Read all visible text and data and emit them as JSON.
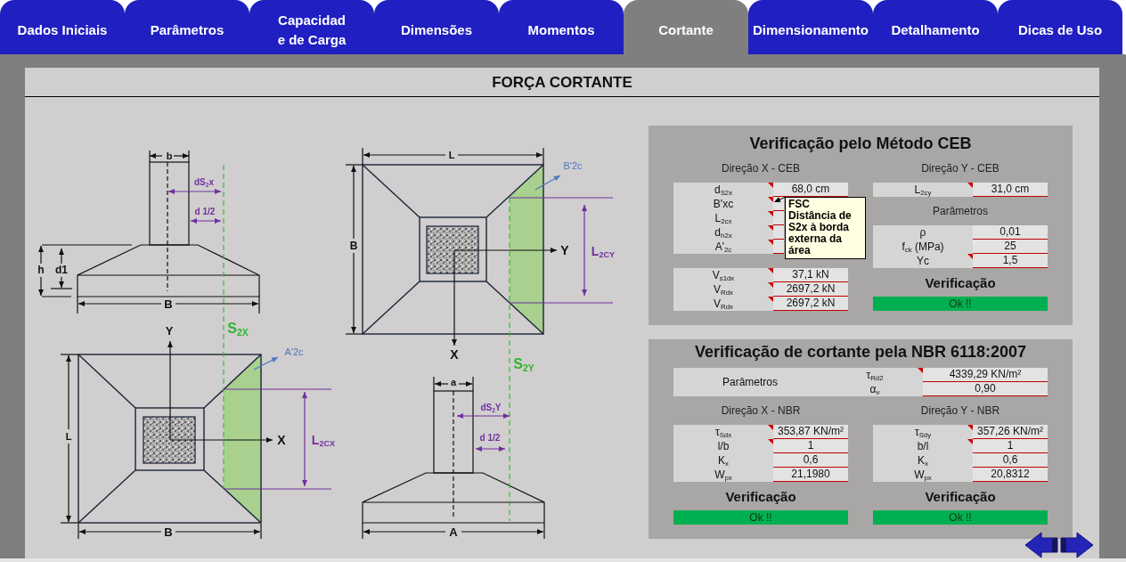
{
  "tabs": [
    {
      "label": "Dados Iniciais",
      "selected": false
    },
    {
      "label": "Parâmetros",
      "selected": false
    },
    {
      "label": "Capacidad\ne de Carga",
      "selected": false
    },
    {
      "label": "Dimensões",
      "selected": false
    },
    {
      "label": "Momentos",
      "selected": false
    },
    {
      "label": "Cortante",
      "selected": true
    },
    {
      "label": "Dimensionamento",
      "selected": false
    },
    {
      "label": "Detalhamento",
      "selected": false
    },
    {
      "label": "Dicas de Uso",
      "selected": false
    }
  ],
  "title": "FORÇA CORTANTE",
  "figure": {
    "labels": [
      "b",
      "L",
      "B'2c",
      "dS$_{2}$x",
      "d 1/2",
      "B",
      "Y",
      "L$_{2CY}$",
      "h",
      "d1",
      "B",
      "Y",
      "S$_{2X}$",
      "A'2c",
      "X",
      "S$_{2Y}$",
      "a",
      "dS$_{2}$Y",
      "L",
      "X",
      "L$_{2CX}$",
      "d 1/2",
      "B",
      "A"
    ]
  },
  "ceb": {
    "title": "Verificação pelo Método CEB",
    "direction_x": {
      "heading": "Direção X - CEB",
      "groups": [
        {
          "rows": [
            {
              "label": "d$_{S2x}$",
              "value": "68,0 cm",
              "note": true
            },
            {
              "label": "B'xc",
              "note": true
            },
            {
              "label": "L$_{2cx}$",
              "note": true
            },
            {
              "label": "d$_{h2x}$",
              "note": true
            },
            {
              "label": "A'$_{2c}$",
              "note": true
            }
          ]
        },
        {
          "rows": [
            {
              "label": "V$_{s1dx}$",
              "value": "37,1 kN",
              "note": true
            },
            {
              "label": "V$_{Rdx}$",
              "value": "2697,2 kN",
              "note": true
            },
            {
              "label": "V$_{Rdx}$",
              "value": "2697,2 kN",
              "note": true
            }
          ]
        }
      ]
    },
    "direction_y": {
      "heading": "Direção Y - CEB",
      "groups": [
        {
          "rows": [
            {
              "label": "L$_{2cy}$",
              "value": "31,0 cm",
              "note": true
            }
          ]
        },
        {
          "heading": "Parâmetros",
          "rows": [
            {
              "label": "ρ",
              "value": "0,01",
              "note": false
            },
            {
              "label": "f$_{ck}$ (MPa)",
              "value": "25",
              "note": false
            },
            {
              "label": "Yc",
              "value": "1,5",
              "note": true
            }
          ]
        }
      ],
      "verification": {
        "heading": "Verificação",
        "status": "Ok !!",
        "passed": true
      }
    },
    "tooltip": {
      "title": "FSC",
      "text": "Distância de S2x à borda externa da área"
    }
  },
  "nbr": {
    "title": "Verificação de cortante pela NBR 6118:2007",
    "parameters": {
      "label": "Parâmetros",
      "rows": [
        {
          "label": "τ$_{Rd2}$",
          "value": "4339,29 KN/m²",
          "note": true
        },
        {
          "label": "α$_{v}$",
          "value": "0,90",
          "note": false
        }
      ]
    },
    "direction_x": {
      "heading": "Direção X - NBR",
      "groups": [
        {
          "rows": [
            {
              "label": "τ$_{Sdx}$",
              "value": "353,87 KN/m²",
              "note": true
            },
            {
              "label": "l/b",
              "value": "1",
              "note": true
            },
            {
              "label": "K$_{x}$",
              "value": "0,6",
              "note": false
            },
            {
              "label": "W$_{px}$",
              "value": "21,1980",
              "note": false
            }
          ]
        }
      ],
      "verification": {
        "heading": "Verificação",
        "status": "Ok !!",
        "passed": true
      }
    },
    "direction_y": {
      "heading": "Direção Y - NBR",
      "groups": [
        {
          "rows": [
            {
              "label": "τ$_{Sdy}$",
              "value": "357,26 KN/m²",
              "note": true
            },
            {
              "label": "b/l",
              "value": "1",
              "note": true
            },
            {
              "label": "K$_{x}$",
              "value": "0,6",
              "note": false
            },
            {
              "label": "W$_{px}$",
              "value": "20,8312",
              "note": false
            }
          ]
        }
      ],
      "verification": {
        "heading": "Verificação",
        "status": "Ok !!",
        "passed": true
      }
    }
  }
}
